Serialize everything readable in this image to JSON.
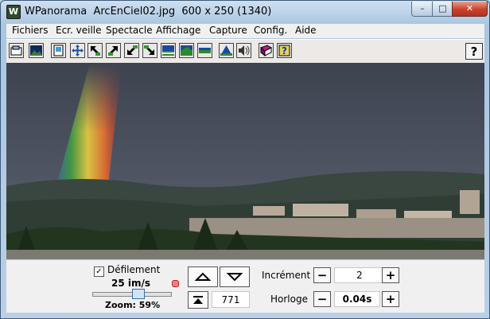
{
  "window": {
    "title": "WPanorama  ArcEnCiel02.jpg  600 x 250 (1340)",
    "minimize": "–",
    "maximize": "□",
    "close": "✕"
  },
  "menu": [
    "Fichiers",
    "Ecr. veille",
    "Spectacle",
    "Affichage",
    "Capture",
    "Config.",
    "Aide"
  ],
  "toolbar": {
    "icons": [
      "open-icon",
      "image-icon",
      "page-icon",
      "move-icon",
      "arrow-nw-icon",
      "arrow-ne-icon",
      "arrow-sw-icon",
      "arrow-se-icon",
      "landscape-icon",
      "landscape-2-icon",
      "flat-icon",
      "mountain-icon",
      "speaker-icon",
      "book-icon",
      "help-book-icon"
    ],
    "help_label": "?"
  },
  "controls": {
    "defilement_checked": true,
    "defilement_label": "Défilement",
    "speed": "25 im/s",
    "zoom": "Zoom: 59%",
    "zoom_level": 0.59,
    "position_value": "771",
    "increment_label": "Incrément",
    "increment_value": "2",
    "horloge_label": "Horloge",
    "horloge_value": "0.04s",
    "minus": "−",
    "plus": "+",
    "check": "✓"
  }
}
